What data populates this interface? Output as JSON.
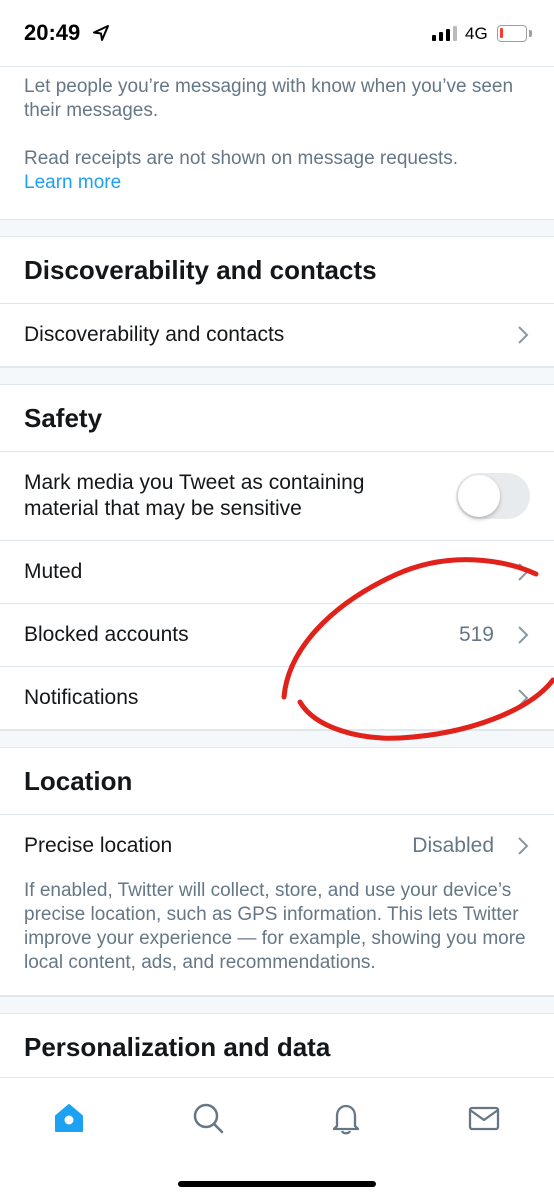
{
  "status_bar": {
    "time": "20:49",
    "network": "4G",
    "location_icon": "location-arrow-icon",
    "signal_icon": "signal-bars-icon",
    "battery_icon": "battery-low-icon",
    "battery_level": 0.12,
    "battery_color": "#ff3b30"
  },
  "read_receipts": {
    "description": "Let people you’re messaging with know when you’ve seen their messages.",
    "note": "Read receipts are not shown on message requests.",
    "learn_more": "Learn more"
  },
  "discoverability": {
    "header": "Discoverability and contacts",
    "row_label": "Discoverability and contacts"
  },
  "safety": {
    "header": "Safety",
    "sensitive_label": "Mark media you Tweet as containing material that may be sensitive",
    "sensitive_enabled": false,
    "muted_label": "Muted",
    "blocked_label": "Blocked accounts",
    "blocked_count": "519",
    "notifications_label": "Notifications"
  },
  "location": {
    "header": "Location",
    "precise_label": "Precise location",
    "precise_value": "Disabled",
    "description": "If enabled, Twitter will collect, store, and use your device’s precise location, such as GPS information. This lets Twitter improve your experience — for example, showing you more local content, ads, and recommendations."
  },
  "personalization": {
    "header": "Personalization and data"
  },
  "tab_bar": {
    "tabs": [
      {
        "icon": "home-icon",
        "active": true
      },
      {
        "icon": "search-icon",
        "active": false
      },
      {
        "icon": "bell-icon",
        "active": false
      },
      {
        "icon": "mail-icon",
        "active": false
      }
    ],
    "accent": "#1da1f2",
    "inactive": "#657786"
  },
  "colors": {
    "text_primary": "#14171a",
    "text_secondary": "#657786",
    "link": "#1da1f2",
    "annotation": "#e0221b"
  }
}
